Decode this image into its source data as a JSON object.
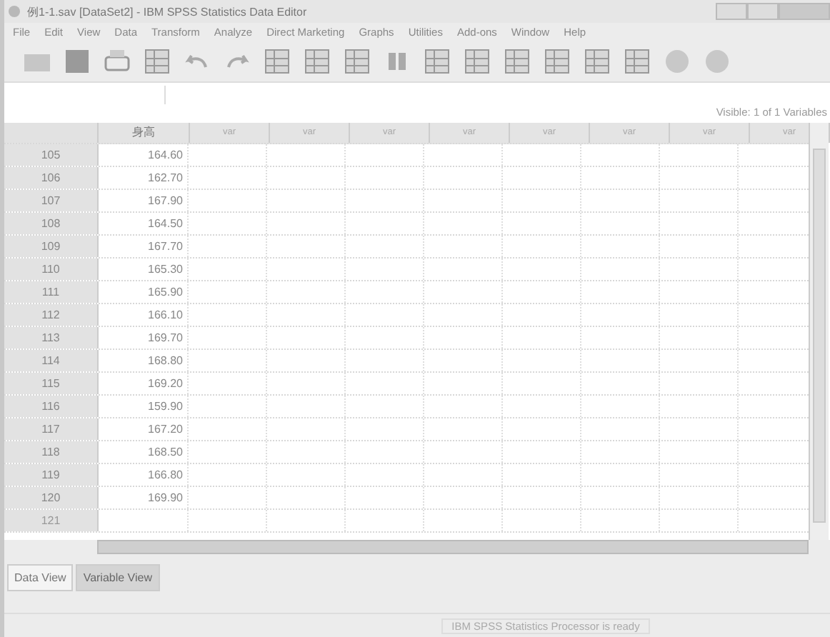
{
  "window": {
    "title": "例1-1.sav [DataSet2] - IBM SPSS Statistics Data Editor"
  },
  "menu": [
    "File",
    "Edit",
    "View",
    "Data",
    "Transform",
    "Analyze",
    "Direct Marketing",
    "Graphs",
    "Utilities",
    "Add-ons",
    "Window",
    "Help"
  ],
  "visible_label": "Visible: 1 of 1 Variables",
  "table": {
    "columns": [
      "身高",
      "var",
      "var",
      "var",
      "var",
      "var",
      "var",
      "var",
      "var"
    ],
    "rows": [
      {
        "n": "105",
        "value": "164.60"
      },
      {
        "n": "106",
        "value": "162.70"
      },
      {
        "n": "107",
        "value": "167.90"
      },
      {
        "n": "108",
        "value": "164.50"
      },
      {
        "n": "109",
        "value": "167.70"
      },
      {
        "n": "110",
        "value": "165.30"
      },
      {
        "n": "111",
        "value": "165.90"
      },
      {
        "n": "112",
        "value": "166.10"
      },
      {
        "n": "113",
        "value": "169.70"
      },
      {
        "n": "114",
        "value": "168.80"
      },
      {
        "n": "115",
        "value": "169.20"
      },
      {
        "n": "116",
        "value": "159.90"
      },
      {
        "n": "117",
        "value": "167.20"
      },
      {
        "n": "118",
        "value": "168.50"
      },
      {
        "n": "119",
        "value": "166.80"
      },
      {
        "n": "120",
        "value": "169.90"
      },
      {
        "n": "121"
      }
    ]
  },
  "tabs": [
    {
      "label": "Data View",
      "selected": true
    },
    {
      "label": "Variable View",
      "selected": false
    }
  ],
  "status_bar": "IBM SPSS Statistics Processor is ready"
}
